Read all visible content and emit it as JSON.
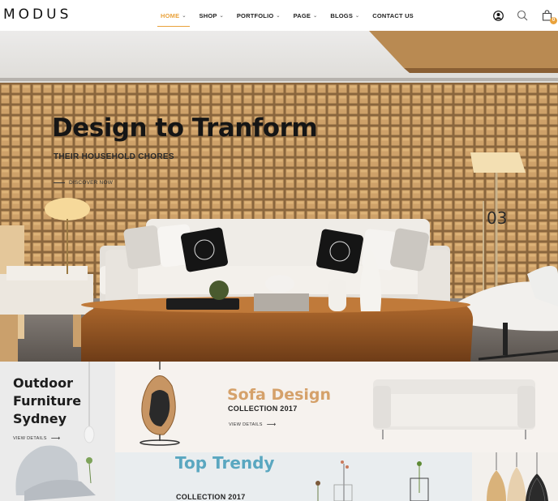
{
  "header": {
    "logo": "MODUS",
    "nav": [
      {
        "label": "HOME",
        "active": true
      },
      {
        "label": "SHOP",
        "active": false
      },
      {
        "label": "PORTFOLIO",
        "active": false
      },
      {
        "label": "PAGE",
        "active": false
      },
      {
        "label": "BLOGS",
        "active": false
      },
      {
        "label": "CONTACT US",
        "active": false
      }
    ],
    "icons": [
      "user-icon",
      "search-icon",
      "cart-icon"
    ],
    "cart_count": "0",
    "accent_color": "#e9a23b"
  },
  "hero": {
    "title": "Design to Tranform",
    "subtitle": "THEIR HOUSEHOLD CHORES",
    "cta": "DISCOVER NOW",
    "slide_number": "03"
  },
  "banners": {
    "outdoor": {
      "title_lines": [
        "Outdoor",
        "Furniture",
        "Sydney"
      ],
      "link": "VIEW DETAILS"
    },
    "sofa": {
      "title": "Sofa Design",
      "subtitle": "COLLECTION 2017",
      "link": "VIEW DETAILS",
      "title_color": "#d5a16a"
    },
    "trendy": {
      "title": "Top Trendy",
      "subtitle": "COLLECTION 2017",
      "title_color": "#5aa7c0"
    }
  }
}
